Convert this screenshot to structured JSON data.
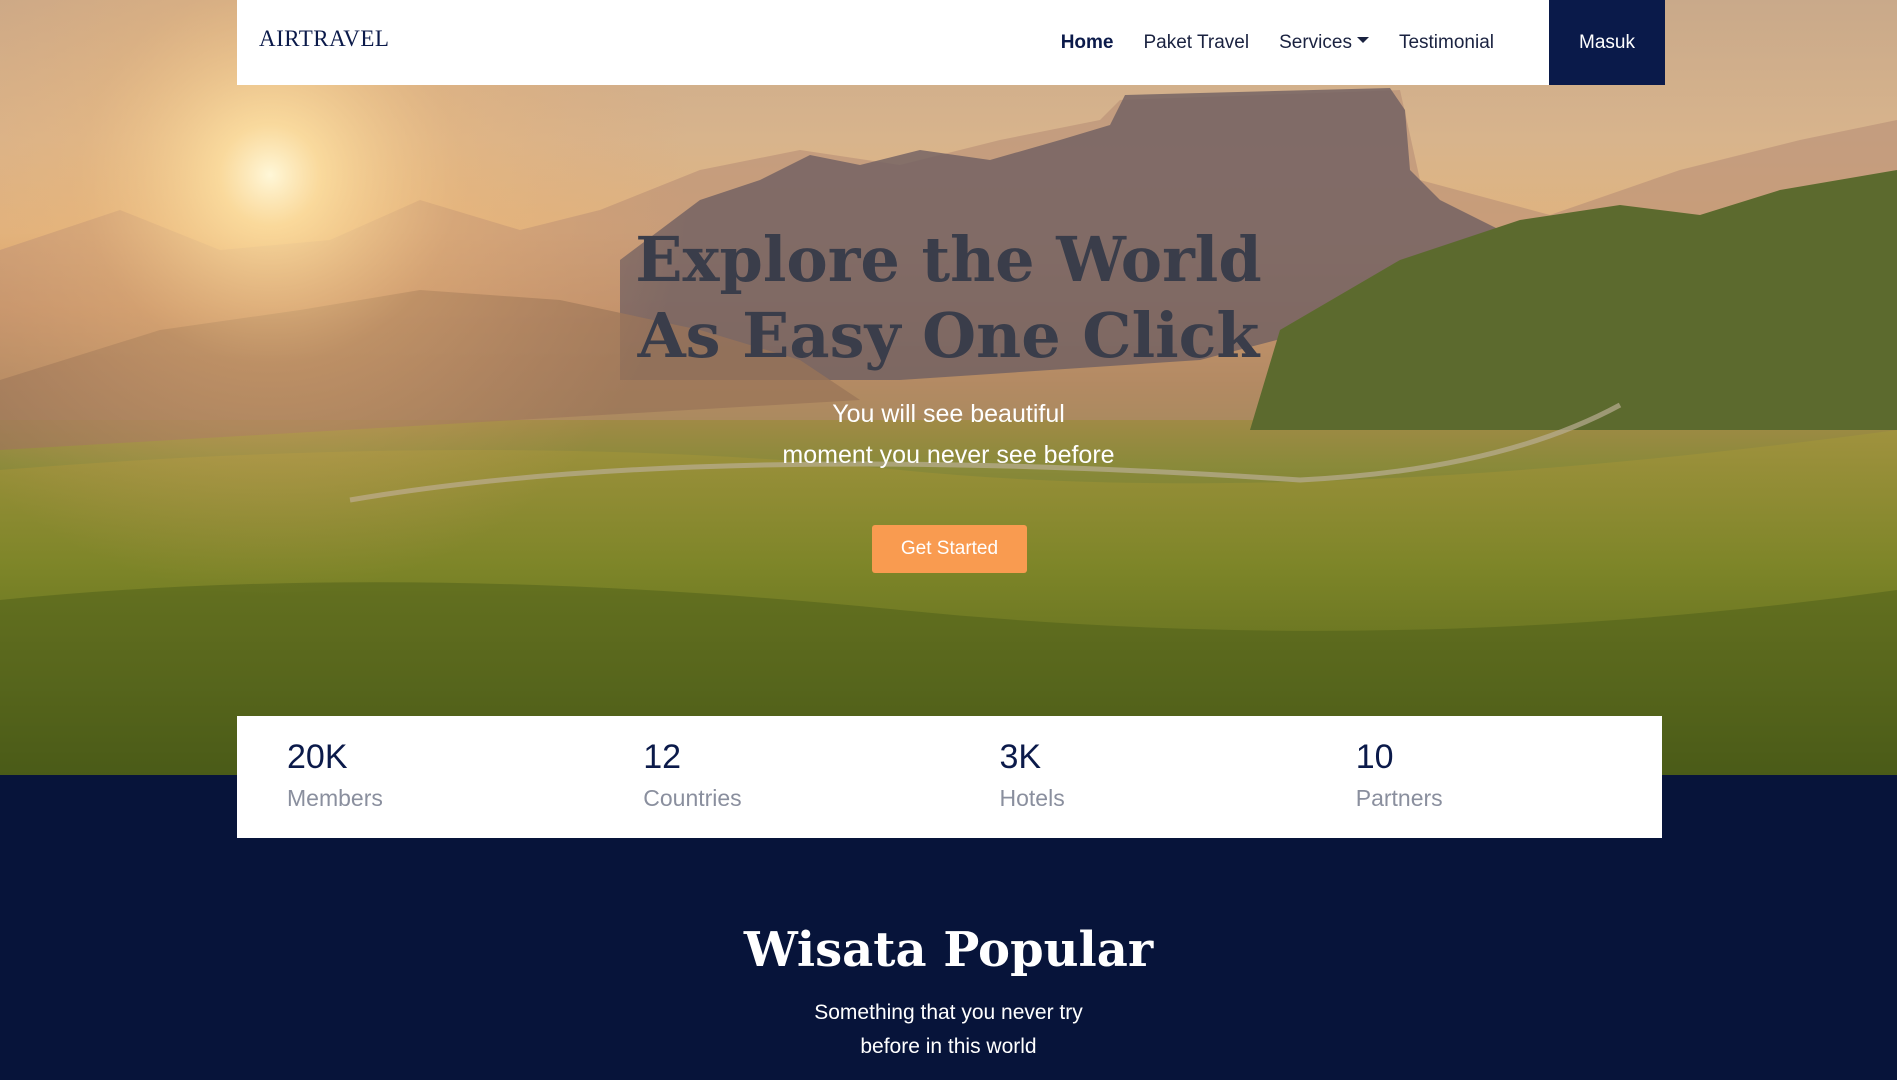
{
  "brand": "AIRTRAVEL",
  "nav": {
    "items": [
      {
        "label": "Home",
        "active": true
      },
      {
        "label": "Paket Travel"
      },
      {
        "label": "Services"
      },
      {
        "label": "Testimonial"
      }
    ],
    "login_label": "Masuk"
  },
  "hero": {
    "title_line1": "Explore the World",
    "title_line2": "As Easy One Click",
    "subtitle_line1": "You will see beautiful",
    "subtitle_line2": "moment you never see before",
    "cta_label": "Get Started"
  },
  "stats": [
    {
      "value": "20K",
      "label": "Members"
    },
    {
      "value": "12",
      "label": "Countries"
    },
    {
      "value": "3K",
      "label": "Hotels"
    },
    {
      "value": "10",
      "label": "Partners"
    }
  ],
  "popular": {
    "title": "Wisata Popular",
    "subtitle_line1": "Something that you never try",
    "subtitle_line2": "before in this world"
  },
  "colors": {
    "primary": "#0a1a4a",
    "accent": "#f99b50",
    "section_bg": "#07143a"
  }
}
